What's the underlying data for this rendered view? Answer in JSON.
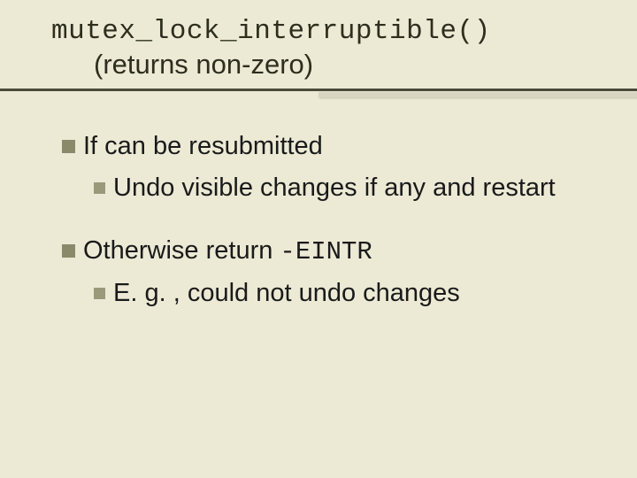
{
  "title": {
    "line1": "mutex_lock_interruptible()",
    "line2": "(returns non-zero)"
  },
  "bullets": [
    {
      "level": 1,
      "text": "If can be resubmitted"
    },
    {
      "level": 2,
      "text": "Undo visible changes if any and restart"
    },
    {
      "level": 1,
      "prefix": "Otherwise return ",
      "code": "-EINTR"
    },
    {
      "level": 2,
      "text": "E. g. , could not undo changes"
    }
  ]
}
